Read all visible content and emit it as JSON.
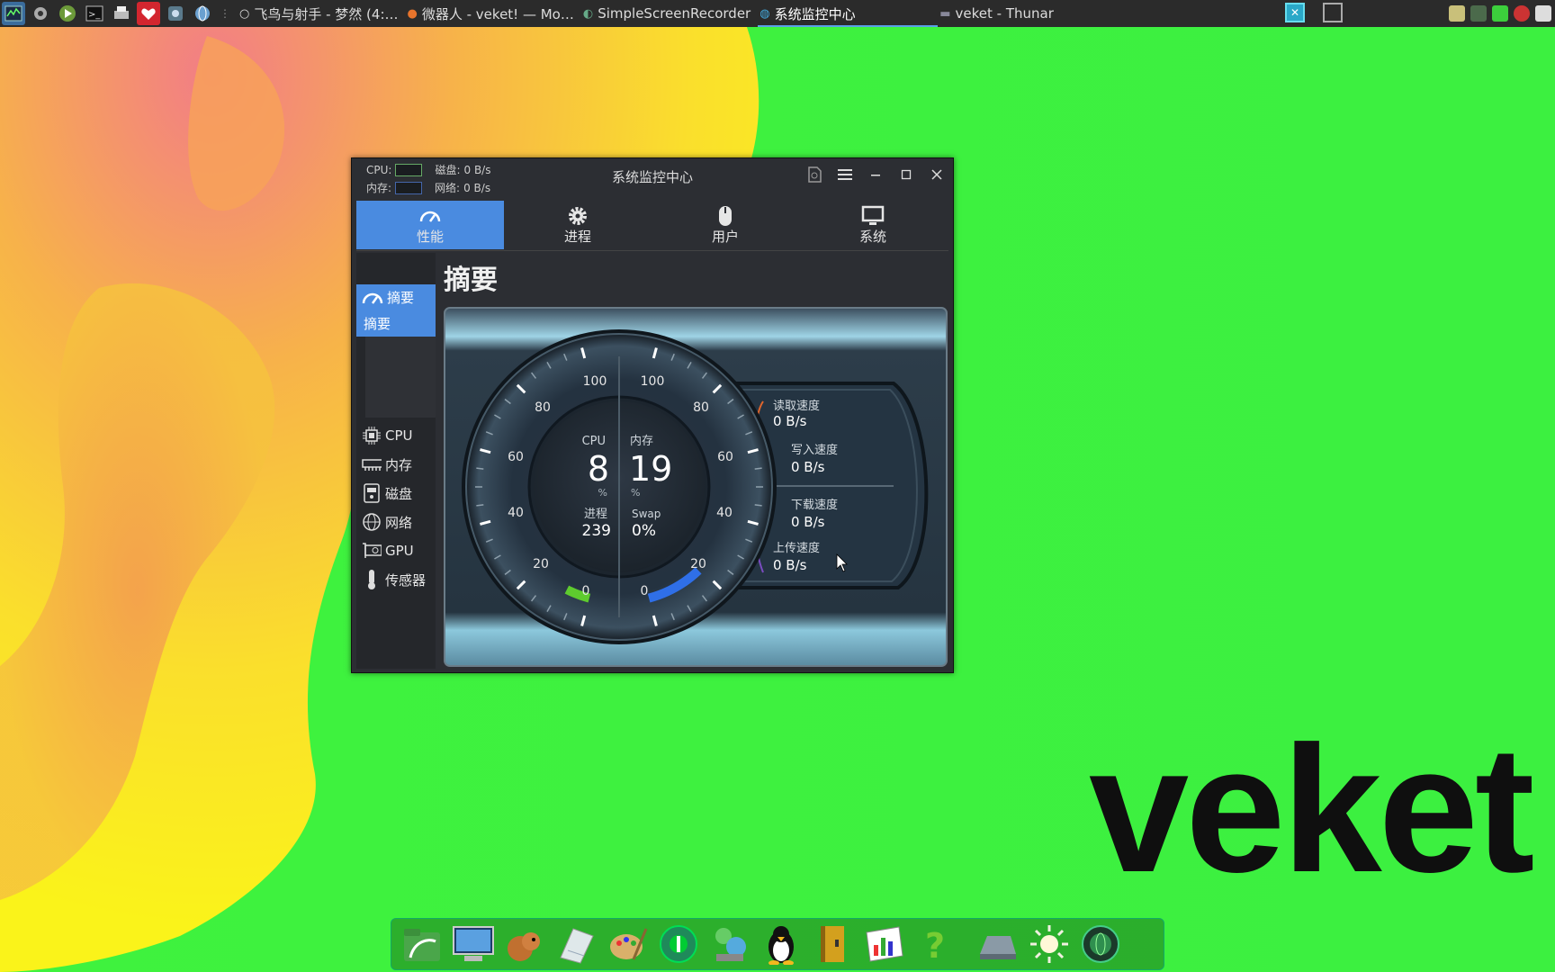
{
  "panel": {
    "launchers": [
      {
        "icon": "system-monitor-icon"
      },
      {
        "icon": "settings-icon"
      },
      {
        "icon": "play-icon"
      },
      {
        "icon": "terminal-icon"
      },
      {
        "icon": "printer-icon"
      },
      {
        "icon": "heart-app-icon"
      },
      {
        "icon": "network-icon"
      },
      {
        "icon": "globe-icon"
      }
    ],
    "tasks": [
      {
        "label": "飞鸟与射手 - 梦然 (4:…",
        "icon": "music-icon"
      },
      {
        "label": "微器人 - veket! — Mo…",
        "icon": "firefox-icon"
      },
      {
        "label": "SimpleScreenRecorder",
        "icon": "recorder-icon"
      },
      {
        "label": "系统监控中心",
        "icon": "monitor-icon",
        "active": true
      },
      {
        "label": "veket - Thunar",
        "icon": "folder-icon"
      }
    ]
  },
  "window": {
    "title": "系统监控中心",
    "mini": {
      "cpu_label": "CPU:",
      "mem_label": "内存:",
      "disk_label": "磁盘:",
      "disk_value": "0 B/s",
      "net_label": "网络:",
      "net_value": "0 B/s"
    },
    "tabs": [
      {
        "label": "性能",
        "icon": "gauge-icon"
      },
      {
        "label": "进程",
        "icon": "gear-icon"
      },
      {
        "label": "用户",
        "icon": "mouse-icon"
      },
      {
        "label": "系统",
        "icon": "display-icon"
      }
    ],
    "sidebar": {
      "header": "摘要",
      "sub": "摘要",
      "items": [
        {
          "label": "CPU",
          "icon": "cpu-icon"
        },
        {
          "label": "内存",
          "icon": "memory-icon"
        },
        {
          "label": "磁盘",
          "icon": "disk-icon"
        },
        {
          "label": "网络",
          "icon": "globe-icon"
        },
        {
          "label": "GPU",
          "icon": "gpu-icon"
        },
        {
          "label": "传感器",
          "icon": "thermometer-icon"
        }
      ]
    },
    "page_title": "摘要",
    "gauge": {
      "left_ticks": [
        "100",
        "80",
        "60",
        "40",
        "20",
        "0"
      ],
      "right_ticks": [
        "100",
        "80",
        "60",
        "40",
        "20",
        "0"
      ],
      "cpu_label": "CPU",
      "cpu_value": "8",
      "cpu_unit": "%",
      "cpu_percent": 8,
      "mem_label": "内存",
      "mem_value": "19",
      "mem_unit": "%",
      "mem_percent": 19,
      "proc_label": "进程",
      "proc_value": "239",
      "swap_label": "Swap",
      "swap_value": "0%",
      "read_label": "读取速度",
      "read_value": "0 B/s",
      "write_label": "写入速度",
      "write_value": "0 B/s",
      "down_label": "下载速度",
      "down_value": "0 B/s",
      "up_label": "上传速度",
      "up_value": "0 B/s",
      "cpu_color": "#5ecb2e",
      "mem_color": "#2f6fe8"
    }
  },
  "watermark": "veket",
  "dock": {
    "items": [
      "file-manager-icon",
      "monitor-app-icon",
      "squirrel-icon",
      "notes-icon",
      "paint-icon",
      "green-app-icon",
      "network-tools-icon",
      "penguin-icon",
      "book-icon",
      "chart-app-icon",
      "help-icon",
      "drive-icon",
      "sun-icon",
      "globe-app-icon"
    ]
  }
}
